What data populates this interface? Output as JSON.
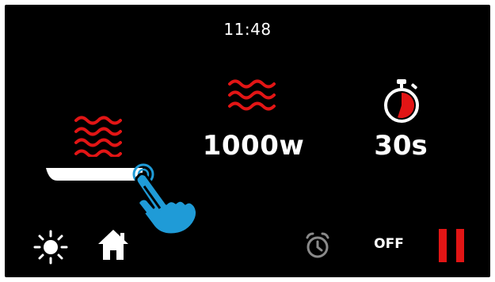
{
  "status_bar": {
    "time": "11:48"
  },
  "power": {
    "value": "1000w"
  },
  "timer": {
    "value": "30s",
    "progress_fraction": 0.55
  },
  "slider": {
    "level": 0.85
  },
  "bottom_bar": {
    "sun_icon": "sun-icon",
    "home_icon": "home-icon",
    "alarm_icon": "alarm-clock-icon",
    "off_label": "OFF",
    "pause_icon": "pause-icon"
  },
  "colors": {
    "background": "#000000",
    "heat_red": "#e21515",
    "accent_blue": "#1f9bd7",
    "text": "#ffffff",
    "muted_icon": "#8a8a8a"
  }
}
